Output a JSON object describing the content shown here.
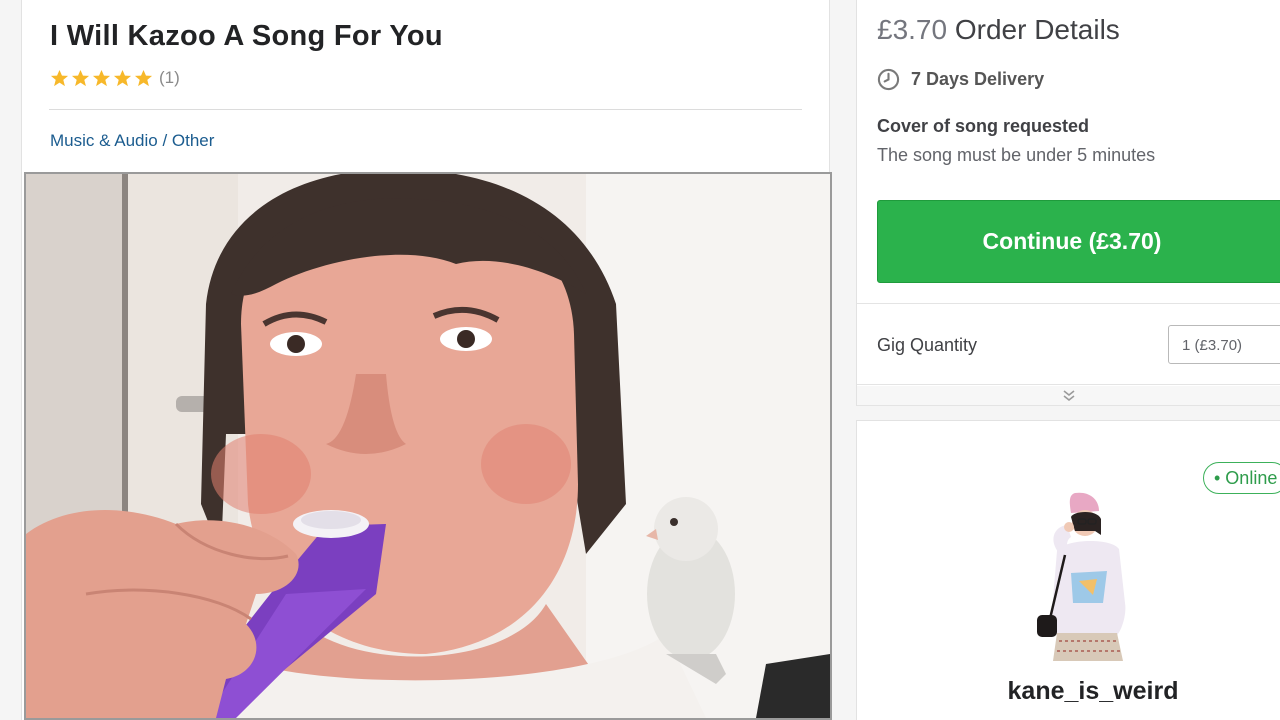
{
  "gig": {
    "title": "I Will Kazoo A Song For You",
    "rating": {
      "stars": 5,
      "count_label": "(1)"
    },
    "breadcrumb": {
      "category": "Music & Audio",
      "separator": " / ",
      "subcategory": "Other"
    },
    "image_icon": "person-playing-kazoo-with-bird-photo"
  },
  "order": {
    "price": "£3.70",
    "heading": " Order Details",
    "delivery_icon": "clock-icon",
    "delivery": "7 Days Delivery",
    "requirement_title": "Cover of song requested",
    "requirement_desc": "The song must be under 5 minutes",
    "continue_label": "Continue (£3.70)",
    "quantity_label": "Gig Quantity",
    "quantity_value": "1 (£3.70)"
  },
  "seller": {
    "status": "• Online",
    "username": "kane_is_weird"
  },
  "colors": {
    "accent_green": "#2bb24c",
    "star": "#f7b82a",
    "link": "#1b5c8f"
  }
}
